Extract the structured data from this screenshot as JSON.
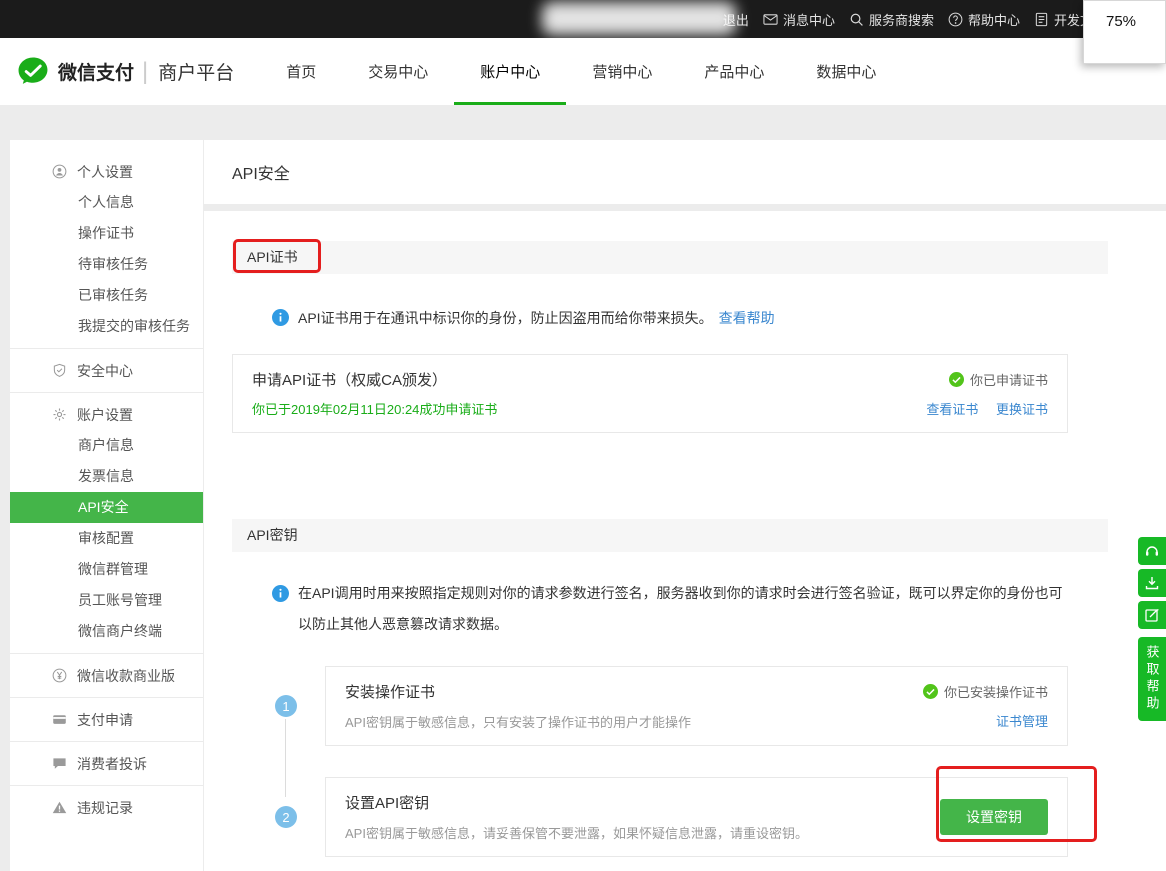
{
  "topbar": {
    "logout_label": "退出",
    "items": [
      {
        "icon": "mail-icon",
        "label": "消息中心"
      },
      {
        "icon": "search-icon",
        "label": "服务商搜索"
      },
      {
        "icon": "question-icon",
        "label": "帮助中心"
      },
      {
        "icon": "document-icon",
        "label": "开发文档"
      }
    ]
  },
  "zoom_popup": {
    "value": "75%"
  },
  "header": {
    "brand": "微信支付",
    "platform": "商户平台",
    "tabs": [
      {
        "label": "首页"
      },
      {
        "label": "交易中心"
      },
      {
        "label": "账户中心",
        "active": true
      },
      {
        "label": "营销中心"
      },
      {
        "label": "产品中心"
      },
      {
        "label": "数据中心"
      }
    ]
  },
  "sidebar": {
    "groups": [
      {
        "header": {
          "icon": "user-icon",
          "label": "个人设置"
        },
        "items": [
          {
            "label": "个人信息"
          },
          {
            "label": "操作证书"
          },
          {
            "label": "待审核任务"
          },
          {
            "label": "已审核任务"
          },
          {
            "label": "我提交的审核任务"
          }
        ]
      },
      {
        "header": {
          "icon": "shield-icon",
          "label": "安全中心"
        },
        "items": []
      },
      {
        "header": {
          "icon": "gear-icon",
          "label": "账户设置"
        },
        "items": [
          {
            "label": "商户信息"
          },
          {
            "label": "发票信息"
          },
          {
            "label": "API安全",
            "active": true
          },
          {
            "label": "审核配置"
          },
          {
            "label": "微信群管理"
          },
          {
            "label": "员工账号管理"
          },
          {
            "label": "微信商户终端"
          }
        ]
      },
      {
        "header": {
          "icon": "coin-icon",
          "label": "微信收款商业版"
        },
        "items": []
      },
      {
        "header": {
          "icon": "card-icon",
          "label": "支付申请"
        },
        "items": []
      },
      {
        "header": {
          "icon": "chat-icon",
          "label": "消费者投诉"
        },
        "items": []
      },
      {
        "header": {
          "icon": "warning-icon",
          "label": "违规记录"
        },
        "items": []
      }
    ]
  },
  "main": {
    "page_title": "API安全",
    "cert_section": {
      "title": "API证书",
      "info": "API证书用于在通讯中标识你的身份，防止因盗用而给你带来损失。",
      "help_link": "查看帮助",
      "card": {
        "title": "申请API证书（权威CA颁发）",
        "subtitle": "你已于2019年02月11日20:24成功申请证书",
        "status": "你已申请证书",
        "links": [
          "查看证书",
          "更换证书"
        ]
      }
    },
    "key_section": {
      "title": "API密钥",
      "info": "在API调用时用来按照指定规则对你的请求参数进行签名，服务器收到你的请求时会进行签名验证，既可以界定你的身份也可以防止其他人恶意篡改请求数据。",
      "steps": [
        {
          "num": "1",
          "title": "安装操作证书",
          "desc": "API密钥属于敏感信息，只有安装了操作证书的用户才能操作",
          "status": "你已安装操作证书",
          "link": "证书管理"
        },
        {
          "num": "2",
          "title": "设置API密钥",
          "desc": "API密钥属于敏感信息，请妥善保管不要泄露，如果怀疑信息泄露，请重设密钥。",
          "button": "设置密钥"
        }
      ]
    }
  },
  "float_widget": {
    "buttons": [
      {
        "icon": "customer-service-icon"
      },
      {
        "icon": "download-icon"
      },
      {
        "icon": "feedback-icon"
      }
    ],
    "help_label": "获取帮助"
  },
  "colors": {
    "wechat_green": "#1aad19",
    "button_green": "#44b549",
    "widget_green": "#17b926",
    "link_blue": "#3a87cf",
    "info_blue": "#2f9ae3",
    "check_green": "#52c41a",
    "step_circle_blue": "#7cbfe9",
    "annotation_red": "#e41e1e"
  }
}
